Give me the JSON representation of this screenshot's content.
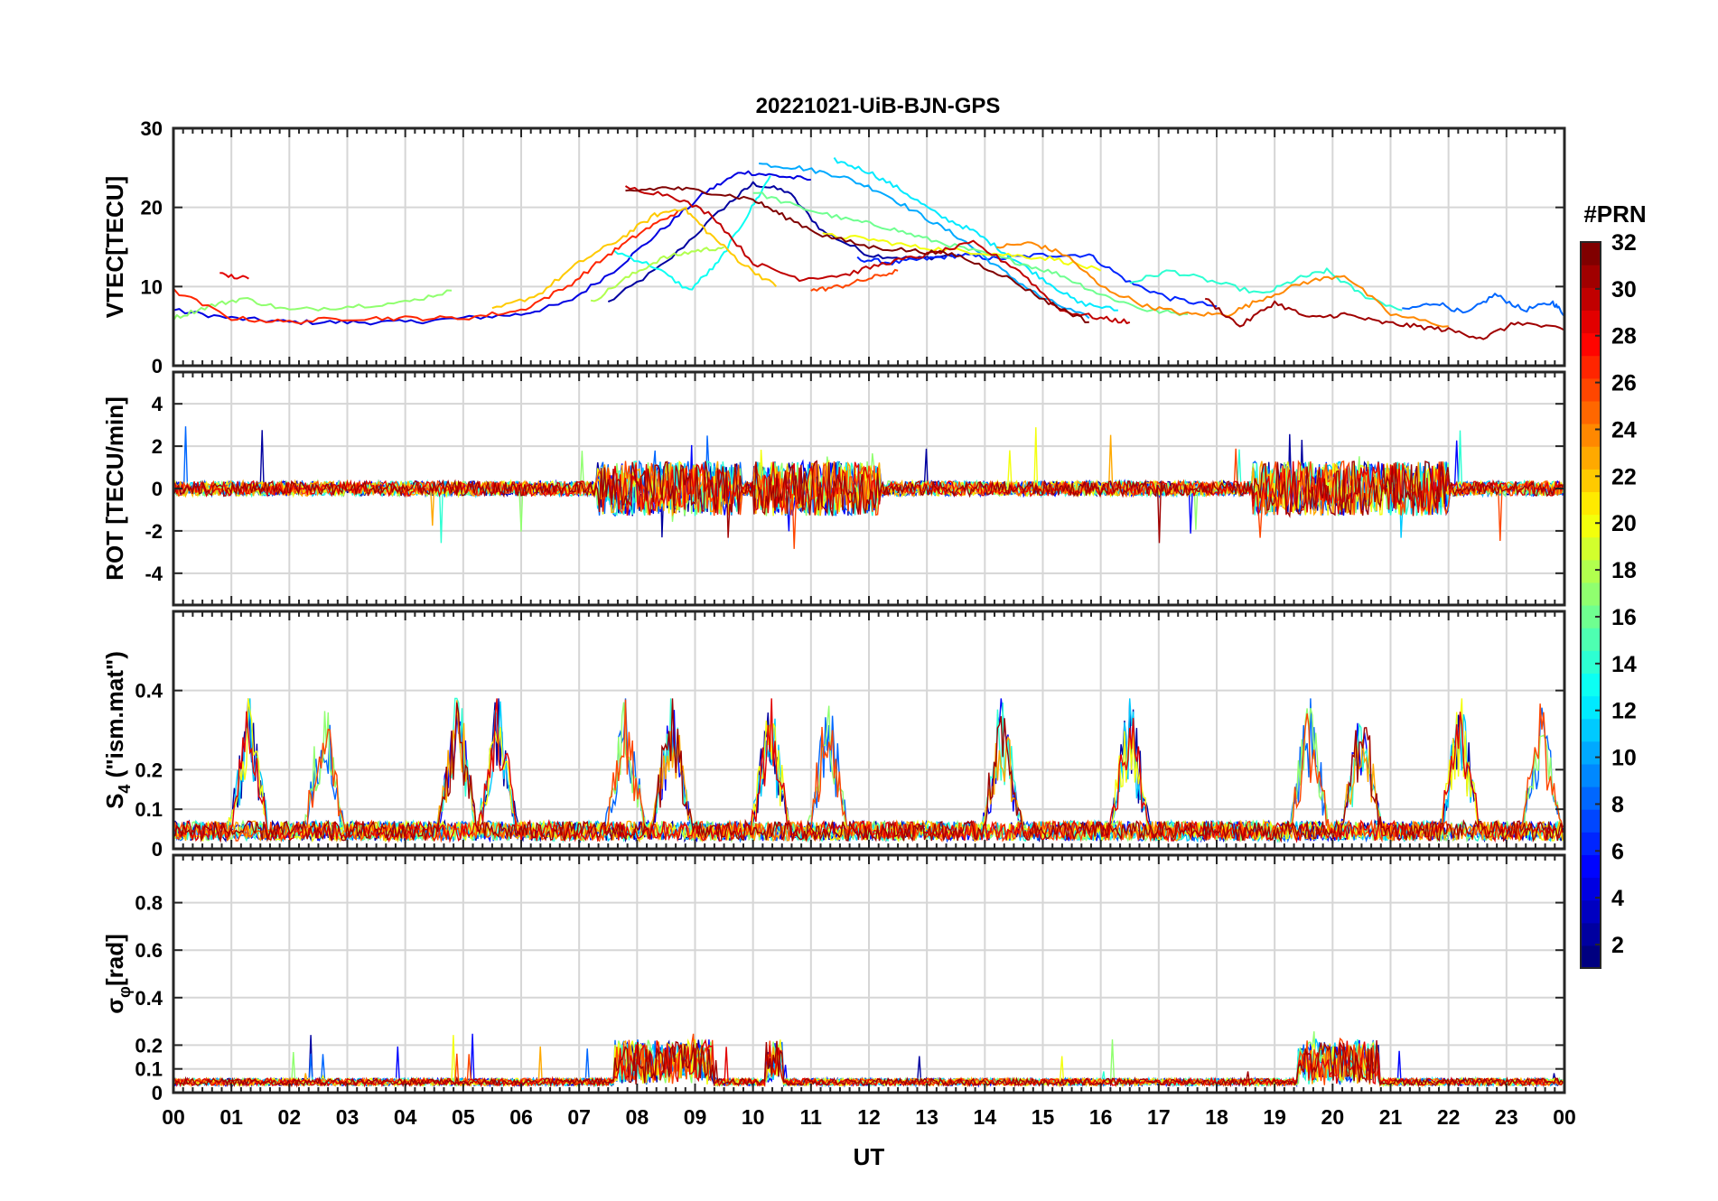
{
  "chart_data": {
    "type": "line",
    "title": "20221021-UiB-BJN-GPS",
    "xlabel": "UT",
    "x_ticks": [
      "00",
      "01",
      "02",
      "03",
      "04",
      "05",
      "06",
      "07",
      "08",
      "09",
      "10",
      "11",
      "12",
      "13",
      "14",
      "15",
      "16",
      "17",
      "18",
      "19",
      "20",
      "21",
      "22",
      "23",
      "00"
    ],
    "xlim_hours": [
      0,
      24
    ],
    "grid": true,
    "colorbar": {
      "title": "#PRN",
      "colormap": "jet",
      "range": [
        1,
        32
      ],
      "ticks": [
        2,
        4,
        6,
        8,
        10,
        12,
        14,
        16,
        18,
        20,
        22,
        24,
        26,
        28,
        30,
        32
      ]
    },
    "panels": [
      {
        "id": "vtec",
        "ylabel": "VTEC[TECU]",
        "ylim": [
          0,
          30
        ],
        "yticks": [
          0,
          10,
          20,
          30
        ],
        "series": [
          {
            "prn": 2,
            "x": [
              7.5,
              8.5,
              9.5,
              10.0,
              10.6,
              11.2,
              12.0,
              12.8,
              13.5
            ],
            "y": [
              8,
              13,
              20,
              23,
              22,
              17,
              14,
              13.5,
              14
            ]
          },
          {
            "prn": 4,
            "x": [
              0.0,
              1.0,
              2.0,
              3.0,
              4.0,
              5.0,
              6.0,
              6.8,
              7.6,
              8.4,
              9.2,
              9.8,
              10.4,
              11.0
            ],
            "y": [
              7,
              6,
              5.5,
              5.5,
              5.5,
              6,
              6.5,
              8,
              12,
              17,
              22,
              24.5,
              24,
              23.5
            ]
          },
          {
            "prn": 6,
            "x": [
              11.8,
              12.4,
              13.0,
              13.6,
              14.2,
              15.0,
              15.8,
              16.5,
              17.2,
              18.0
            ],
            "y": [
              13.5,
              13,
              13.5,
              14,
              13.5,
              14,
              14,
              10.5,
              8.5,
              7.5
            ]
          },
          {
            "prn": 8,
            "x": [
              21.2,
              21.8,
              22.3,
              22.8,
              23.3,
              23.8,
              24.0
            ],
            "y": [
              7,
              8,
              6.5,
              9,
              7,
              8,
              6.5
            ]
          },
          {
            "prn": 10,
            "x": [
              10.1,
              10.8,
              11.5,
              12.2,
              12.9,
              13.6,
              14.3,
              15.0,
              15.8
            ],
            "y": [
              25.5,
              25,
              24,
              22,
              19,
              16,
              12,
              8.5,
              6
            ]
          },
          {
            "prn": 12,
            "x": [
              11.4,
              12.0,
              12.6,
              13.2,
              13.8,
              14.4,
              15.0,
              15.6,
              16.3
            ],
            "y": [
              26,
              24.5,
              22,
              19,
              17,
              14,
              11,
              8,
              7
            ]
          },
          {
            "prn": 13,
            "x": [
              7.6,
              8.3,
              8.9,
              9.4,
              9.9,
              10.3
            ],
            "y": [
              14.5,
              12.5,
              9.5,
              13,
              19,
              24
            ]
          },
          {
            "prn": 14,
            "x": [
              16.5,
              17.2,
              18.0,
              18.8,
              19.4,
              19.9,
              20.5,
              21.2
            ],
            "y": [
              10.5,
              12,
              10.5,
              9,
              11,
              12,
              9,
              7
            ]
          },
          {
            "prn": 16,
            "x": [
              10.0,
              10.8,
              11.6,
              12.3,
              13.0,
              13.8,
              14.6,
              15.3,
              16.0,
              16.8,
              17.5
            ],
            "y": [
              22,
              20,
              18.5,
              17.5,
              16,
              14.5,
              13,
              11.5,
              9,
              7,
              6.5
            ]
          },
          {
            "prn": 17,
            "x": [
              0.0,
              0.6,
              1.2,
              2.0,
              3.0,
              4.0,
              4.8
            ],
            "y": [
              6,
              7.5,
              8.5,
              7,
              7.5,
              8,
              9.5
            ]
          },
          {
            "prn": 18,
            "x": [
              7.2,
              7.8,
              8.4,
              9.0,
              9.5
            ],
            "y": [
              8,
              11,
              13.5,
              14.5,
              15
            ]
          },
          {
            "prn": 20,
            "x": [
              11.2,
              12.0,
              12.8,
              13.6,
              14.4,
              15.2,
              16.0
            ],
            "y": [
              16.5,
              16,
              15,
              14.5,
              14,
              13.5,
              12
            ]
          },
          {
            "prn": 22,
            "x": [
              5.5,
              6.3,
              7.0,
              7.7,
              8.3,
              8.8,
              9.2,
              9.8,
              10.4
            ],
            "y": [
              7,
              9,
              13,
              16,
              19,
              20,
              17,
              13,
              10
            ]
          },
          {
            "prn": 24,
            "x": [
              14.2,
              14.8,
              15.4,
              16.0,
              16.8,
              17.5,
              18.2,
              18.8,
              19.5,
              20.2,
              21.0,
              22.0
            ],
            "y": [
              15,
              15.5,
              14,
              10,
              7.5,
              6.5,
              6.5,
              8.5,
              10.5,
              11.5,
              6.5,
              5
            ]
          },
          {
            "prn": 26,
            "x": [
              11.0,
              11.5,
              12.0,
              12.5
            ],
            "y": [
              9.5,
              10,
              11,
              12
            ]
          },
          {
            "prn": 27,
            "x": [
              0.0,
              1.0,
              2.0,
              3.0,
              4.0,
              5.0,
              6.0,
              6.8,
              7.5,
              8.1,
              8.7
            ],
            "y": [
              9.5,
              6,
              5.5,
              6,
              6,
              6,
              7,
              10,
              14,
              17,
              19.5
            ]
          },
          {
            "prn": 29,
            "x": [
              0.8,
              1.3
            ],
            "y": [
              11.5,
              11
            ]
          },
          {
            "prn": 30,
            "x": [
              7.8,
              8.6,
              9.3,
              10.0,
              10.8,
              11.6,
              12.3,
              13.0,
              13.8,
              14.6,
              15.3,
              16.0,
              16.5
            ],
            "y": [
              22.5,
              21.5,
              19,
              13,
              11,
              11.5,
              13,
              14,
              15.5,
              12,
              7,
              6,
              5.5
            ]
          },
          {
            "prn": 31,
            "x": [
              17.8,
              18.4,
              19.0,
              19.6,
              20.2,
              20.8,
              21.4,
              22.0,
              22.6,
              23.2,
              24.0
            ],
            "y": [
              8.5,
              5,
              8,
              6,
              6.5,
              5.5,
              5,
              4.5,
              3.5,
              5.5,
              4.5
            ]
          },
          {
            "prn": 32,
            "x": [
              7.8,
              8.5,
              9.2,
              10.0,
              10.5,
              11.2,
              12.0,
              12.8,
              13.5,
              14.3,
              15.1,
              15.8
            ],
            "y": [
              22,
              22.5,
              22,
              21,
              19,
              16.5,
              15,
              14.5,
              14,
              11.5,
              8,
              5.5
            ]
          }
        ]
      },
      {
        "id": "rot",
        "ylabel": "ROT [TECU/min]",
        "ylim": [
          -5.5,
          5.5
        ],
        "yticks": [
          -4,
          -2,
          0,
          2,
          4
        ],
        "peaks": {
          "max": 4.1,
          "min": -4.0
        },
        "active_intervals_hours": [
          [
            7.3,
            9.8
          ],
          [
            10.0,
            12.2
          ],
          [
            18.6,
            22.0
          ]
        ]
      },
      {
        "id": "s4",
        "ylabel": "S4 (\"ism.mat\")",
        "ylabel_main": "S",
        "ylabel_sub": "4",
        "ylabel_rest": " (\"ism.mat\")",
        "ylim": [
          0,
          0.6
        ],
        "yticks": [
          0,
          0.1,
          0.2,
          0.4
        ],
        "peaks_hours": [
          1.3,
          2.6,
          4.9,
          5.6,
          7.8,
          8.6,
          10.3,
          11.3,
          14.3,
          16.5,
          19.6,
          20.5,
          22.2,
          23.6
        ],
        "peak_max": 0.38
      },
      {
        "id": "sigma_phi",
        "ylabel": "σφ[rad]",
        "ylabel_main": "σ",
        "ylabel_sub": "φ",
        "ylabel_rest": "[rad]",
        "ylim": [
          0,
          1
        ],
        "yticks": [
          0,
          0.1,
          0.2,
          0.4,
          0.6,
          0.8
        ],
        "enhanced_intervals_hours": [
          [
            7.6,
            9.3
          ],
          [
            10.2,
            10.5
          ],
          [
            19.4,
            20.8
          ]
        ],
        "peak_max": 0.31
      }
    ]
  }
}
